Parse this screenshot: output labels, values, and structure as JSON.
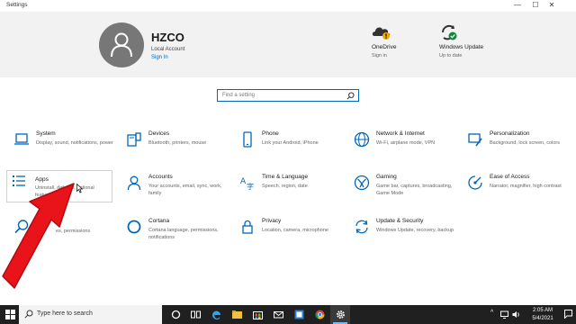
{
  "window": {
    "title": "Settings",
    "minimize": "—",
    "maximize": "☐",
    "close": "✕"
  },
  "account": {
    "name": "HZCO",
    "type": "Local Account",
    "sign_in": "Sign In"
  },
  "header_tiles": [
    {
      "title": "OneDrive",
      "sub": "Sign in",
      "icon": "onedrive-icon"
    },
    {
      "title": "Windows Update",
      "sub": "Up to date",
      "icon": "windows-update-icon"
    }
  ],
  "search": {
    "placeholder": "Find a setting"
  },
  "tiles": [
    {
      "title": "System",
      "desc": "Display, sound, notifications, power",
      "icon": "laptop-icon"
    },
    {
      "title": "Devices",
      "desc": "Bluetooth, printers, mouse",
      "icon": "devices-icon"
    },
    {
      "title": "Phone",
      "desc": "Link your Android, iPhone",
      "icon": "phone-icon"
    },
    {
      "title": "Network & Internet",
      "desc": "Wi-Fi, airplane mode, VPN",
      "icon": "globe-icon"
    },
    {
      "title": "Personalization",
      "desc": "Background, lock screen, colors",
      "icon": "paint-icon"
    },
    {
      "title": "Apps",
      "desc": "Uninstall, defaults, optional features",
      "icon": "apps-list-icon"
    },
    {
      "title": "Accounts",
      "desc": "Your accounts, email, sync, work, family",
      "icon": "person-icon"
    },
    {
      "title": "Time & Language",
      "desc": "Speech, region, date",
      "icon": "time-language-icon"
    },
    {
      "title": "Gaming",
      "desc": "Game bar, captures, broadcasting, Game Mode",
      "icon": "xbox-icon"
    },
    {
      "title": "Ease of Access",
      "desc": "Narrator, magnifier, high contrast",
      "icon": "ease-of-access-icon"
    },
    {
      "title": "",
      "desc": "es, permissions",
      "icon": "search-icon"
    },
    {
      "title": "Cortana",
      "desc": "Cortana language, permissions, notifications",
      "icon": "cortana-icon"
    },
    {
      "title": "Privacy",
      "desc": "Location, camera, microphone",
      "icon": "lock-icon"
    },
    {
      "title": "Update & Security",
      "desc": "Windows Update, recovery, backup",
      "icon": "refresh-icon"
    }
  ],
  "taskbar": {
    "search_placeholder": "Type here to search",
    "time": "2:05 AM",
    "date": "5/4/2021",
    "tray_chevron": "^"
  },
  "colors": {
    "accent": "#0067b8",
    "arrow": "#e8141a",
    "taskbar": "#202020"
  }
}
